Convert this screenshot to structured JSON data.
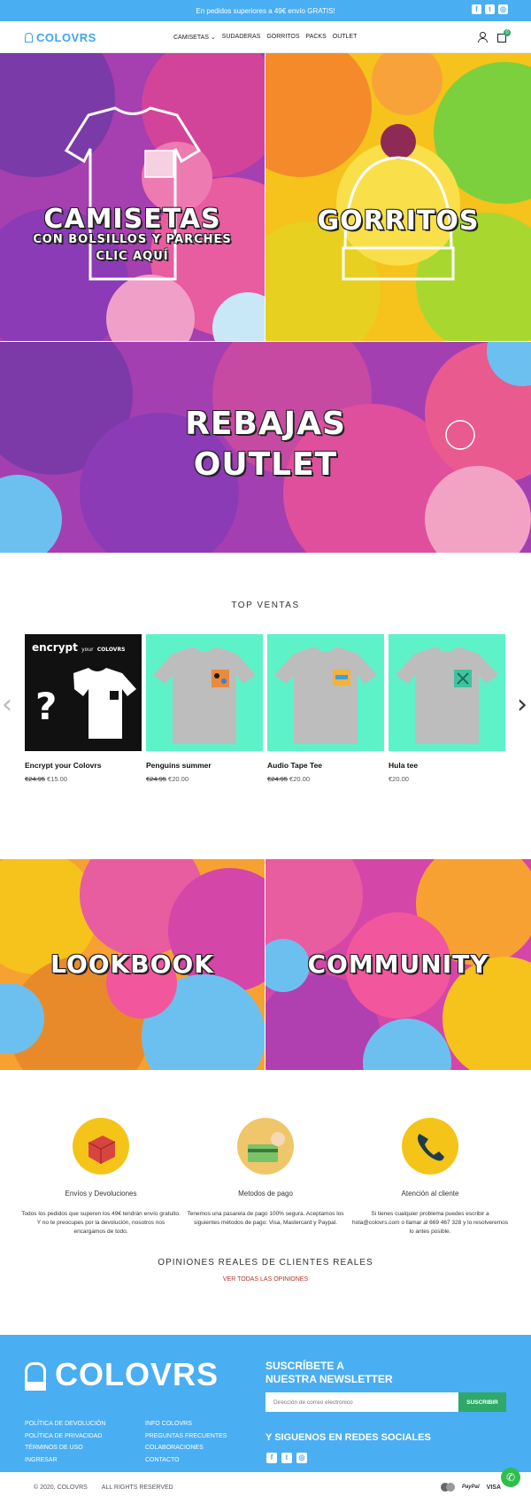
{
  "announcement": {
    "text": "En pedidos superiores a 49€ envío GRATIS!",
    "social_icons": [
      "facebook-icon",
      "twitter-icon",
      "instagram-icon"
    ]
  },
  "header": {
    "logo_text": "COLOVRS",
    "nav": [
      "CAMISETAS ⌄",
      "SUDADERAS",
      "GORRITOS",
      "PACKS",
      "OUTLET"
    ],
    "cart_count": "0"
  },
  "hero": {
    "camisetas": {
      "title": "CAMISETAS",
      "subtitle": "CON BOLSILLOS Y PARCHES",
      "cta": "CLIC AQUÍ"
    },
    "gorritos": {
      "title": "GORRITOS"
    },
    "outlet": {
      "line1": "REBAJAS",
      "line2": "OUTLET"
    }
  },
  "top_ventas": {
    "heading": "TOP VENTAS",
    "encrypt_image_text": {
      "big": "encrypt",
      "small": "your",
      "brand": "COLOVRS"
    },
    "products": [
      {
        "name": "Encrypt your Colovrs",
        "old_price": "€24.95",
        "price": "€15.00"
      },
      {
        "name": "Penguins summer",
        "old_price": "€24.95",
        "price": "€20.00"
      },
      {
        "name": "Audio Tape Tee",
        "old_price": "€24.95",
        "price": "€20.00"
      },
      {
        "name": "Hula tee",
        "old_price": "",
        "price": "€20.00"
      }
    ]
  },
  "banners": {
    "lookbook": "LOOKBOOK",
    "community": "COMMUNITY"
  },
  "features": [
    {
      "title": "Envíos y Devoluciones",
      "text": "Todos los pedidos que superen los 49€ tendrán envío gratuito. Y no te preocupes por la devolución, nosotros nos encargamos de todo."
    },
    {
      "title": "Metodos de pago",
      "text": "Tenemos una pasarela de pago 100% segura. Aceptamos los siguientes métodos de pago: Visa, Mastercard y Paypal."
    },
    {
      "title": "Atención al cliente",
      "text": "Si tienes cualquier problema puedes escribir a hola@colovrs.com o llamar al 669 467 328 y lo resolveremos lo antes posible."
    }
  ],
  "reviews": {
    "heading": "OPINIONES REALES DE CLIENTES REALES",
    "link": "VER TODAS LAS OPINIONES"
  },
  "footer": {
    "logo_text": "COLOVRS",
    "links_col1": [
      "POLÍTICA DE DEVOLUCIÓN",
      "POLÍTICA DE PRIVACIDAD",
      "TÉRMINOS DE USO",
      "INGRESAR"
    ],
    "links_col2": [
      "INFO COLOVRS",
      "PREGUNTAS FRECUENTES",
      "COLABORACIONES",
      "CONTACTO"
    ],
    "newsletter_title_1": "SUSCRÍBETE A",
    "newsletter_title_2": "NUESTRA NEWSLETTER",
    "email_placeholder": "Dirección de correo electrónico",
    "subscribe": "SUSCRIBIR",
    "follow": "Y SIGUENOS EN REDES SOCIALES"
  },
  "bottom": {
    "copyright": "© 2020, COLOVRS",
    "rights": "ALL RIGHTS RESERVED",
    "payments": [
      "PayPal",
      "VISA"
    ]
  },
  "colors": {
    "accent": "#4aaef2",
    "green": "#2fa86a",
    "link_red": "#b0342b"
  }
}
